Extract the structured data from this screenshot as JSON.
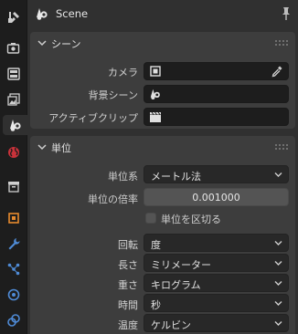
{
  "header": {
    "context_title": "Scene"
  },
  "tabs": [
    {
      "name": "tool",
      "icon": "tool-icon"
    },
    {
      "name": "render",
      "icon": "render-icon"
    },
    {
      "name": "output",
      "icon": "output-icon"
    },
    {
      "name": "view-layer",
      "icon": "view-layer-icon"
    },
    {
      "name": "scene",
      "icon": "scene-icon",
      "active": true
    },
    {
      "name": "world",
      "icon": "world-icon"
    },
    {
      "name": "collection",
      "icon": "collection-icon"
    },
    {
      "name": "object",
      "icon": "object-icon"
    },
    {
      "name": "modifiers",
      "icon": "wrench-icon"
    },
    {
      "name": "particles",
      "icon": "particles-icon"
    },
    {
      "name": "physics",
      "icon": "physics-icon"
    },
    {
      "name": "constraints",
      "icon": "constraints-icon"
    }
  ],
  "scene_panel": {
    "title": "シーン",
    "camera_label": "カメラ",
    "camera_value": "",
    "background_scene_label": "背景シーン",
    "active_clip_label": "アクティブクリップ"
  },
  "units_panel": {
    "title": "単位",
    "unit_system_label": "単位系",
    "unit_system_value": "メートル法",
    "unit_scale_label": "単位の倍率",
    "unit_scale_value": "0.001000",
    "separate_units_label": "単位を区切る",
    "separate_units_checked": false,
    "rotation_label": "回転",
    "rotation_value": "度",
    "length_label": "長さ",
    "length_value": "ミリメーター",
    "mass_label": "重さ",
    "mass_value": "キログラム",
    "time_label": "時間",
    "time_value": "秒",
    "temperature_label": "温度",
    "temperature_value": "ケルビン"
  },
  "colors": {
    "tab_strip": "#1d1d1d",
    "panel": "#3d3d3d",
    "background": "#303030",
    "scene_icon": "#e8e8e8",
    "world_icon": "#c8323a",
    "object_icon": "#e68a2e",
    "modifier_icon": "#4f8bd6"
  }
}
